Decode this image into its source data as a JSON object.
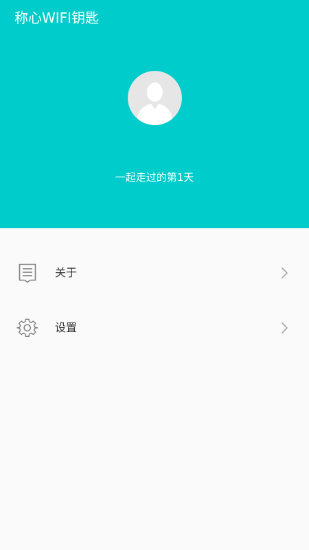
{
  "app": {
    "title": "称心WIFI钥匙"
  },
  "profile": {
    "avatar_icon": "default-user-avatar",
    "days_text": "一起走过的第1天"
  },
  "menu": {
    "items": [
      {
        "label": "关于",
        "icon": "document-icon",
        "trailing_icon": "chevron-right-icon"
      },
      {
        "label": "设置",
        "icon": "gear-icon",
        "trailing_icon": "chevron-right-icon"
      }
    ]
  },
  "colors": {
    "header_background": "#00cccb",
    "page_background": "#fafafa",
    "avatar_background": "#e6e6e6",
    "avatar_figure": "#ffffff",
    "menu_label": "#333333",
    "icon_stroke": "#808080",
    "chevron": "#a6a6a6"
  }
}
